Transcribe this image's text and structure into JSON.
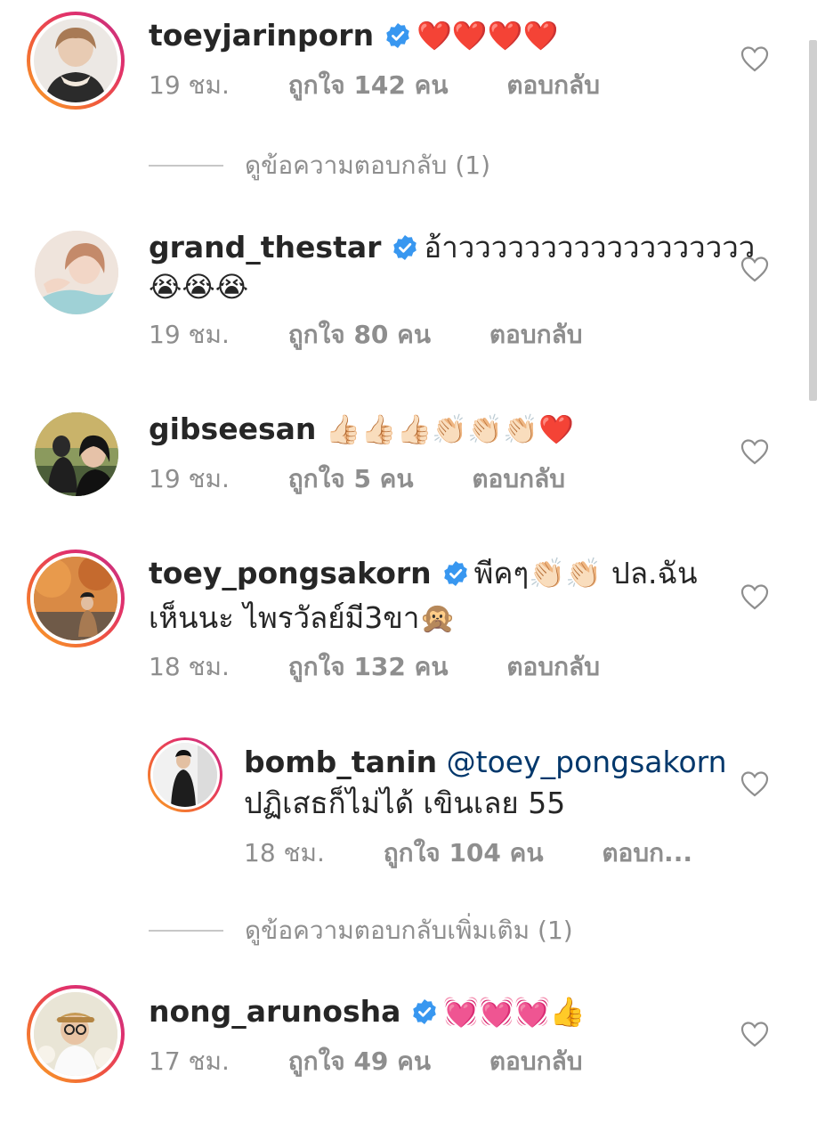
{
  "labels": {
    "like_prefix": "ถูกใจ",
    "like_suffix": "คน",
    "reply": "ตอบกลับ",
    "reply_truncated": "ตอบก..."
  },
  "comments": [
    {
      "username": "toeyjarinporn",
      "verified": true,
      "text": "❤️❤️❤️❤️",
      "time": "19 ชม.",
      "likes": "142"
    },
    {
      "username": "grand_thestar",
      "verified": true,
      "text": "อ้าวววววววววววววววววว",
      "text2": "😭😭😭",
      "time": "19 ชม.",
      "likes": "80"
    },
    {
      "username": "gibseesan",
      "verified": false,
      "text": "👍🏻👍🏻👍🏻👏🏻👏🏻👏🏻❤️",
      "time": "19 ชม.",
      "likes": "5"
    },
    {
      "username": "toey_pongsakorn",
      "verified": true,
      "text": "พีคๆ👏🏻👏🏻 ปล.ฉัน",
      "text2": "เห็นนะ ไพรวัลย์มี3ขา🙊",
      "time": "18 ชม.",
      "likes": "132"
    },
    {
      "username": "bomb_tanin",
      "verified": false,
      "mention": "@toey_pongsakorn",
      "text2": "ปฏิเสธก็ไม่ได้ เขินเลย 55",
      "time": "18 ชม.",
      "likes": "104"
    },
    {
      "username": "nong_arunosha",
      "verified": true,
      "text": "💓💓💓👍",
      "time": "17 ชม.",
      "likes": "49"
    }
  ],
  "view_replies": {
    "first": "ดูข้อความตอบกลับ (1)",
    "more": "ดูข้อความตอบกลับเพิ่มเติม (1)"
  },
  "colors": {
    "username": "#262626",
    "meta": "#8e8e8e",
    "mention": "#00376b",
    "verified": "#3897f0"
  }
}
